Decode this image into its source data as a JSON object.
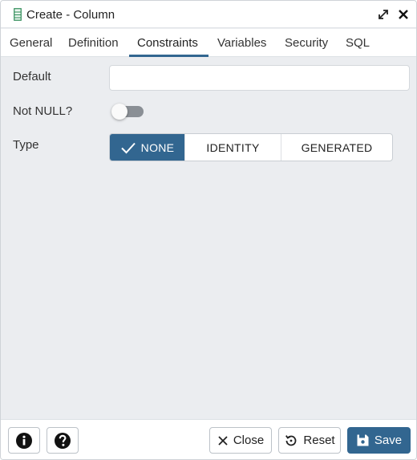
{
  "window": {
    "title": "Create - Column"
  },
  "tabs": [
    {
      "label": "General"
    },
    {
      "label": "Definition"
    },
    {
      "label": "Constraints"
    },
    {
      "label": "Variables"
    },
    {
      "label": "Security"
    },
    {
      "label": "SQL"
    }
  ],
  "active_tab": "Constraints",
  "form": {
    "default": {
      "label": "Default",
      "value": "",
      "placeholder": ""
    },
    "not_null": {
      "label": "Not NULL?",
      "checked": false
    },
    "type": {
      "label": "Type",
      "options": [
        {
          "label": "NONE"
        },
        {
          "label": "IDENTITY"
        },
        {
          "label": "GENERATED"
        }
      ],
      "selected": "NONE"
    }
  },
  "footer": {
    "info_icon": "info-circle-icon",
    "help_icon": "question-circle-icon",
    "close_label": "Close",
    "reset_label": "Reset",
    "save_label": "Save"
  },
  "colors": {
    "accent": "#326690",
    "background": "#ebedf0",
    "toggle_off": "#8a8f95"
  }
}
